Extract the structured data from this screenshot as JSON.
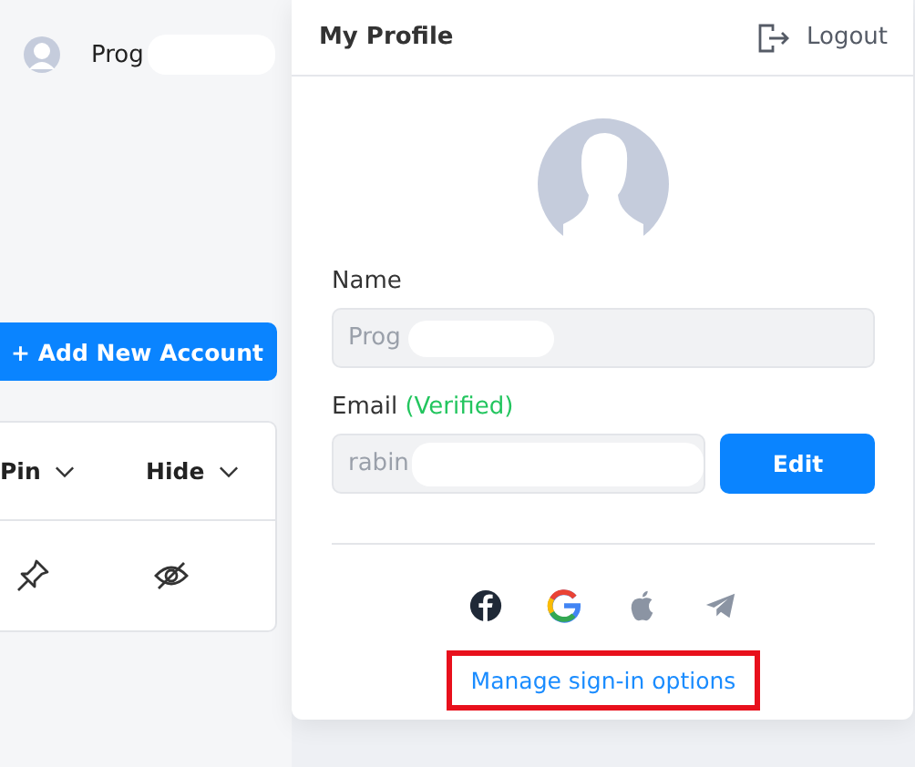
{
  "account_list": {
    "user_name": "Prog",
    "user_name_redacted": true,
    "add_button": "+ Add New Account",
    "columns": [
      {
        "label": "Pin",
        "kind": "pin"
      },
      {
        "label": "Hide",
        "kind": "hide"
      }
    ]
  },
  "profile": {
    "title": "My Profile",
    "logout": "Logout",
    "name_label": "Name",
    "name_value": "Prog",
    "name_redacted": true,
    "email_label": "Email",
    "email_status": "(Verified)",
    "email_value": "rabin",
    "email_redacted": true,
    "edit_button": "Edit",
    "sign_in_methods": [
      {
        "kind": "facebook",
        "linked": true
      },
      {
        "kind": "google",
        "linked": true
      },
      {
        "kind": "apple",
        "linked": false
      },
      {
        "kind": "telegram",
        "linked": false
      }
    ],
    "manage_link": {
      "label": "Manage sign-in options",
      "highlighted": true
    }
  }
}
